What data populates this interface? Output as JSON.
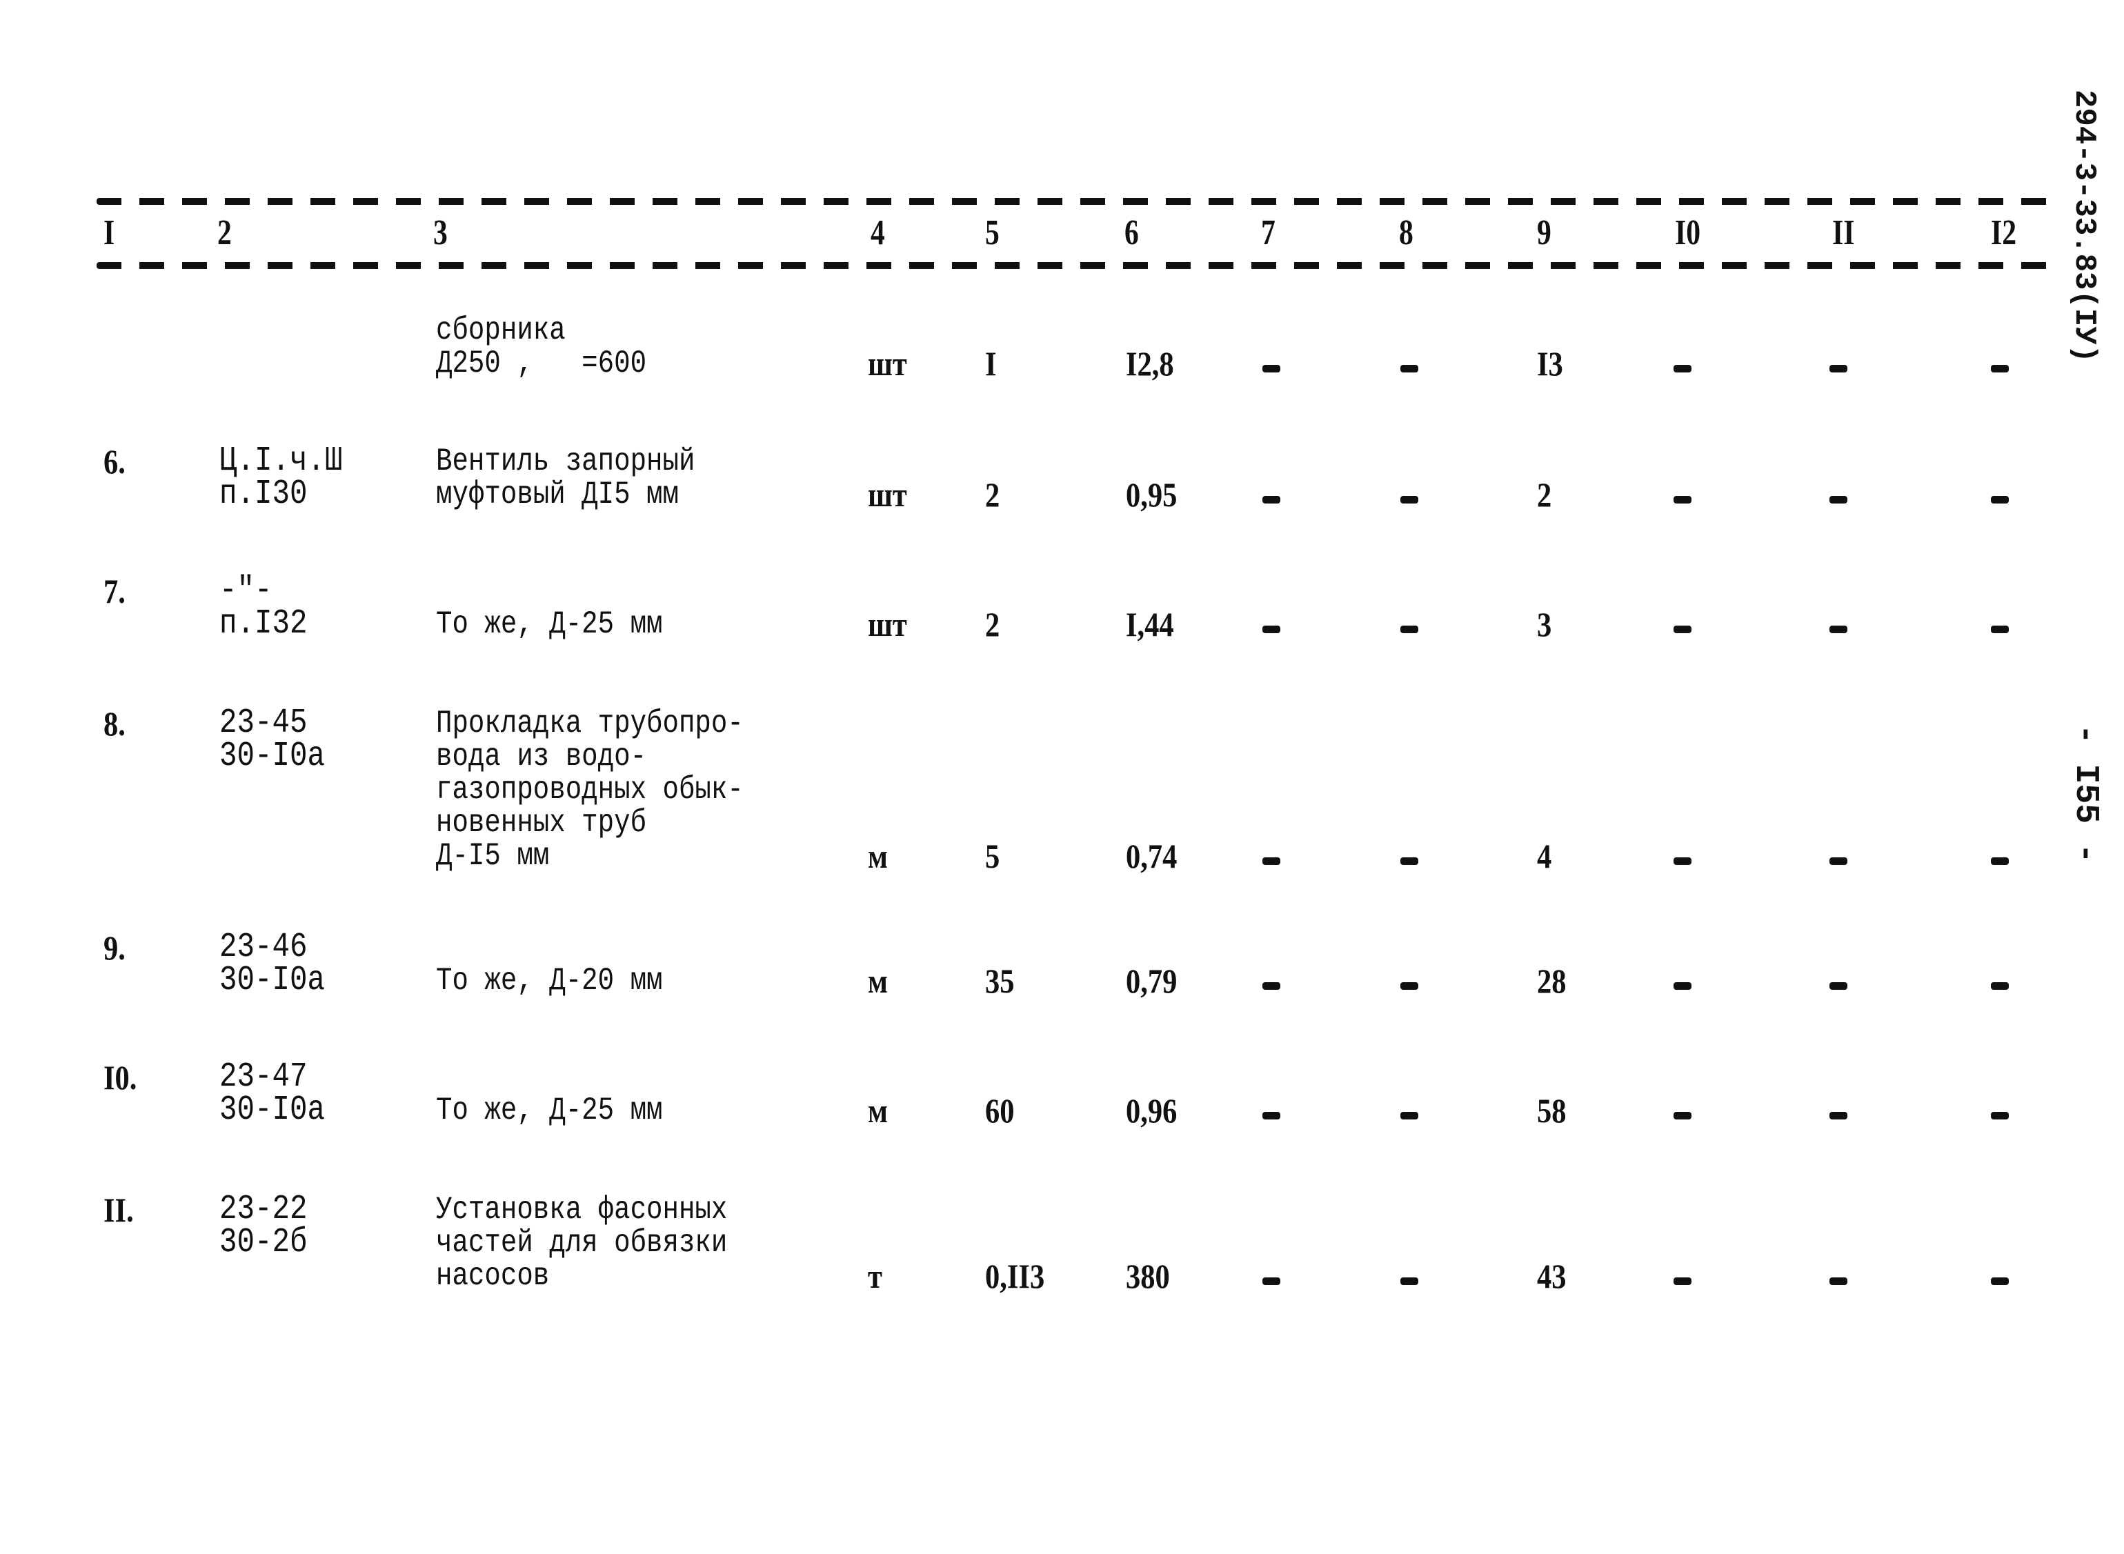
{
  "side": {
    "document_code": "294-3-33.83(IУ)",
    "page_number": "- I55 -"
  },
  "table": {
    "headers": [
      "I",
      "2",
      "3",
      "4",
      "5",
      "6",
      "7",
      "8",
      "9",
      "I0",
      "II",
      "I2"
    ],
    "rows": [
      {
        "no": "",
        "ref": "",
        "desc": "сборника\nД250 ,   =600",
        "unit": "шт",
        "c5": "I",
        "c6": "I2,8",
        "c7": "-",
        "c8": "-",
        "c9": "I3",
        "c10": "-",
        "c11": "-",
        "c12": "-"
      },
      {
        "no": "6.",
        "ref": "Ц.I.ч.Ш\nп.I30",
        "desc": "Вентиль запорный\nмуфтовый ДI5 мм",
        "unit": "шт",
        "c5": "2",
        "c6": "0,95",
        "c7": "-",
        "c8": "-",
        "c9": "2",
        "c10": "-",
        "c11": "-",
        "c12": "-"
      },
      {
        "no": "7.",
        "ref": "-\"-\nп.I32",
        "desc": "\nТо же, Д-25 мм",
        "unit": "шт",
        "c5": "2",
        "c6": "I,44",
        "c7": "-",
        "c8": "-",
        "c9": "3",
        "c10": "-",
        "c11": "-",
        "c12": "-"
      },
      {
        "no": "8.",
        "ref": "23-45\n30-I0а",
        "desc": "Прокладка трубопро-\nвода из водо-\nгазопроводных обык-\nновенных труб\nД-I5 мм",
        "unit": "м",
        "c5": "5",
        "c6": "0,74",
        "c7": "-",
        "c8": "-",
        "c9": "4",
        "c10": "-",
        "c11": "-",
        "c12": "-"
      },
      {
        "no": "9.",
        "ref": "23-46\n30-I0а",
        "desc": "\nТо же, Д-20 мм",
        "unit": "м",
        "c5": "35",
        "c6": "0,79",
        "c7": "-",
        "c8": "-",
        "c9": "28",
        "c10": "-",
        "c11": "-",
        "c12": "-"
      },
      {
        "no": "I0.",
        "ref": "23-47\n30-I0а",
        "desc": "\nТо же, Д-25 мм",
        "unit": "м",
        "c5": "60",
        "c6": "0,96",
        "c7": "-",
        "c8": "-",
        "c9": "58",
        "c10": "-",
        "c11": "-",
        "c12": "-"
      },
      {
        "no": "II.",
        "ref": "23-22\n30-2б",
        "desc": "Установка фасонных\nчастей для обвязки\nнасосов",
        "unit": "т",
        "c5": "0,II3",
        "c6": "380",
        "c7": "-",
        "c8": "-",
        "c9": "43",
        "c10": "-",
        "c11": "-",
        "c12": "-"
      }
    ]
  }
}
